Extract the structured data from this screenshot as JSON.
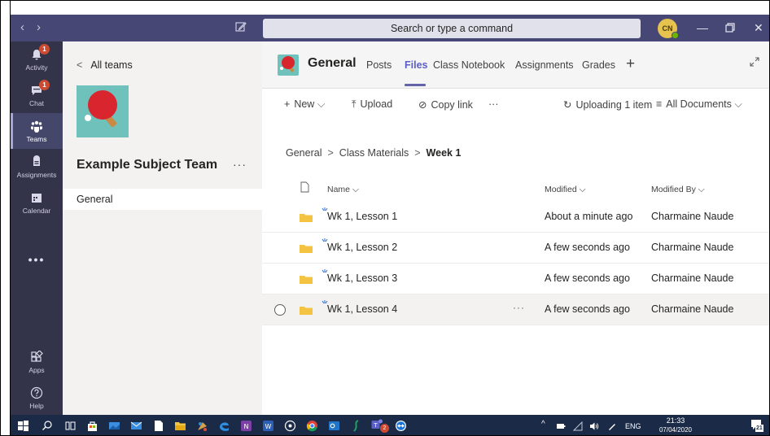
{
  "titlebar": {
    "back_glyph": "‹",
    "forward_glyph": "›",
    "search_placeholder": "Search or type a command",
    "avatar_initials": "CN",
    "minimize_glyph": "—",
    "close_glyph": "✕"
  },
  "appbar": {
    "items": [
      {
        "label": "Activity",
        "icon": "bell-icon",
        "badge": "1"
      },
      {
        "label": "Chat",
        "icon": "chat-icon",
        "badge": "1"
      },
      {
        "label": "Teams",
        "icon": "teams-icon"
      },
      {
        "label": "Assignments",
        "icon": "assignments-icon"
      },
      {
        "label": "Calendar",
        "icon": "calendar-icon"
      }
    ],
    "more": "•••",
    "bottom": [
      {
        "label": "Apps",
        "icon": "apps-icon"
      },
      {
        "label": "Help",
        "icon": "help-icon"
      }
    ]
  },
  "teampanel": {
    "back_label": "All teams",
    "team_name": "Example Subject Team",
    "more": "···",
    "channel": "General"
  },
  "channel_header": {
    "title": "General",
    "tabs": [
      "Posts",
      "Files",
      "Class Notebook",
      "Assignments",
      "Grades"
    ],
    "active_tab": "Files",
    "add_tab": "+"
  },
  "toolbar": {
    "new_label": "New",
    "upload_label": "Upload",
    "copy_link_label": "Copy link",
    "more": "···",
    "uploading_label": "Uploading 1 item",
    "view_label": "All Documents"
  },
  "breadcrumb": {
    "items": [
      "General",
      "Class Materials"
    ],
    "current": "Week 1",
    "separator": ">"
  },
  "table": {
    "headers": {
      "name": "Name",
      "modified": "Modified",
      "modified_by": "Modified By"
    },
    "rows": [
      {
        "name": "Wk 1, Lesson 1",
        "modified": "About a minute ago",
        "modified_by": "Charmaine Naude"
      },
      {
        "name": "Wk 1, Lesson 2",
        "modified": "A few seconds ago",
        "modified_by": "Charmaine Naude"
      },
      {
        "name": "Wk 1, Lesson 3",
        "modified": "A few seconds ago",
        "modified_by": "Charmaine Naude"
      },
      {
        "name": "Wk 1, Lesson 4",
        "modified": "A few seconds ago",
        "modified_by": "Charmaine Naude",
        "row_more": "···"
      }
    ]
  },
  "taskbar": {
    "language": "ENG",
    "time": "21:33",
    "date": "07/04/2020",
    "notification_count": "21",
    "teams_badge": "2"
  },
  "colors": {
    "titlebar": "#464775",
    "appbar": "#33344a",
    "accent": "#6264a7",
    "folder": "#f5c342",
    "badge": "#cc4a31",
    "taskbar": "#1b2a47"
  }
}
